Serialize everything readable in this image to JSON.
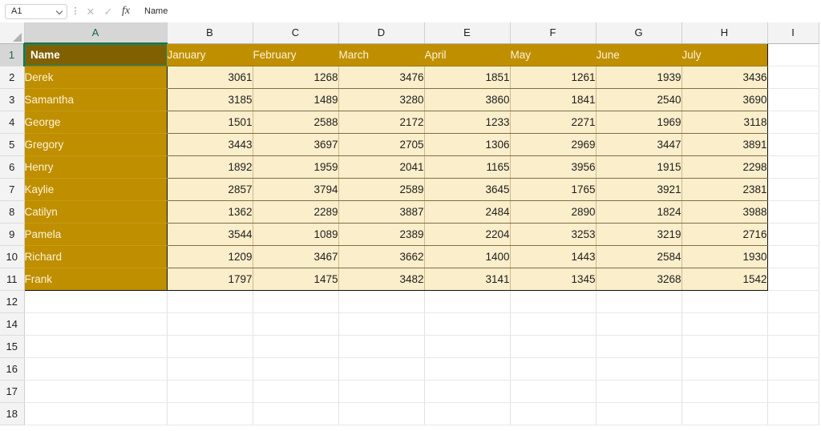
{
  "formula_bar": {
    "name_box_value": "A1",
    "name_box_icon": "chevron-down-icon",
    "kebab_icon": "more-options-icon",
    "cancel_icon": "✕",
    "confirm_icon": "✓",
    "function_icon": "fx",
    "formula_value": "Name"
  },
  "grid": {
    "column_headers": [
      "A",
      "B",
      "C",
      "D",
      "E",
      "F",
      "G",
      "H",
      "I"
    ],
    "selected_column": "A",
    "selected_row": "1",
    "selected_cell": "A1",
    "row_numbers": [
      "1",
      "2",
      "3",
      "4",
      "5",
      "6",
      "7",
      "8",
      "9",
      "10",
      "11",
      "12",
      "14",
      "15",
      "16",
      "17",
      "18"
    ],
    "table_headers": [
      "Name",
      "January",
      "February",
      "March",
      "April",
      "May",
      "June",
      "July"
    ],
    "rows": [
      {
        "name": "Derek",
        "values": [
          3061,
          1268,
          3476,
          1851,
          1261,
          1939,
          3436
        ]
      },
      {
        "name": "Samantha",
        "values": [
          3185,
          1489,
          3280,
          3860,
          1841,
          2540,
          3690
        ]
      },
      {
        "name": "George",
        "values": [
          1501,
          2588,
          2172,
          1233,
          2271,
          1969,
          3118
        ]
      },
      {
        "name": "Gregory",
        "values": [
          3443,
          3697,
          2705,
          1306,
          2969,
          3447,
          3891
        ]
      },
      {
        "name": "Henry",
        "values": [
          1892,
          1959,
          2041,
          1165,
          3956,
          1915,
          2298
        ]
      },
      {
        "name": "Kaylie",
        "values": [
          2857,
          3794,
          2589,
          3645,
          1765,
          3921,
          2381
        ]
      },
      {
        "name": "Catilyn",
        "values": [
          1362,
          2289,
          3887,
          2484,
          2890,
          1824,
          3988
        ]
      },
      {
        "name": "Pamela",
        "values": [
          3544,
          1089,
          2389,
          2204,
          3253,
          3219,
          2716
        ]
      },
      {
        "name": "Richard",
        "values": [
          1209,
          3467,
          3662,
          1400,
          1443,
          2584,
          1930
        ]
      },
      {
        "name": "Frank",
        "values": [
          1797,
          1475,
          3482,
          3141,
          1345,
          3268,
          1542
        ]
      }
    ]
  },
  "colors": {
    "table_header_fill": "#bf8f00",
    "selected_cell_fill": "#806000",
    "data_fill": "#fbeecb",
    "selection_border": "#217346",
    "header_strip": "#f3f3f3"
  }
}
